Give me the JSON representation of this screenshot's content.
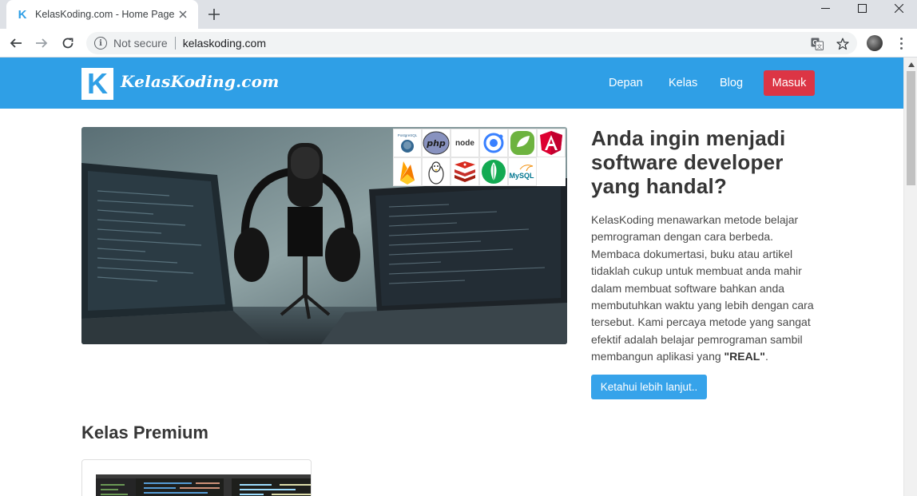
{
  "browser": {
    "tab_title": "KelasKoding.com - Home Page",
    "favicon_letter": "K",
    "security_label": "Not secure",
    "url": "kelaskoding.com"
  },
  "site": {
    "brand_letter": "K",
    "brand_name": "KelasKoding.com",
    "nav": [
      "Depan",
      "Kelas",
      "Blog"
    ],
    "login_label": "Masuk"
  },
  "hero": {
    "heading": "Anda ingin menjadi software developer yang handal?",
    "description_before": "KelasKoding menawarkan metode belajar pemrograman dengan cara berbeda. Membaca dokumertasi, buku atau artikel tidaklah cukup untuk membuat anda mahir dalam membuat software bahkan anda membutuhkan waktu yang lebih dengan cara tersebut. Kami percaya metode yang sangat efektif adalah belajar pemrograman sambil membangun aplikasi yang ",
    "description_emphasis": "\"REAL\"",
    "description_after": ".",
    "cta_label": "Ketahui lebih lanjut..",
    "tech_logos": {
      "postgresql": "PostgreSQL",
      "php": "php",
      "node": "node",
      "mysql": "MySQL"
    }
  },
  "premium": {
    "heading": "Kelas Premium"
  },
  "colors": {
    "brand_blue": "#2f9fe6",
    "danger_red": "#dc3545",
    "button_blue": "#36a3ea"
  },
  "icons": [
    "kelaskoding-favicon-icon",
    "close-icon",
    "new-tab-icon",
    "minimize-icon",
    "maximize-icon",
    "window-close-icon",
    "back-icon",
    "forward-icon",
    "reload-icon",
    "info-icon",
    "translate-icon",
    "star-icon",
    "profile-avatar",
    "menu-icon"
  ]
}
